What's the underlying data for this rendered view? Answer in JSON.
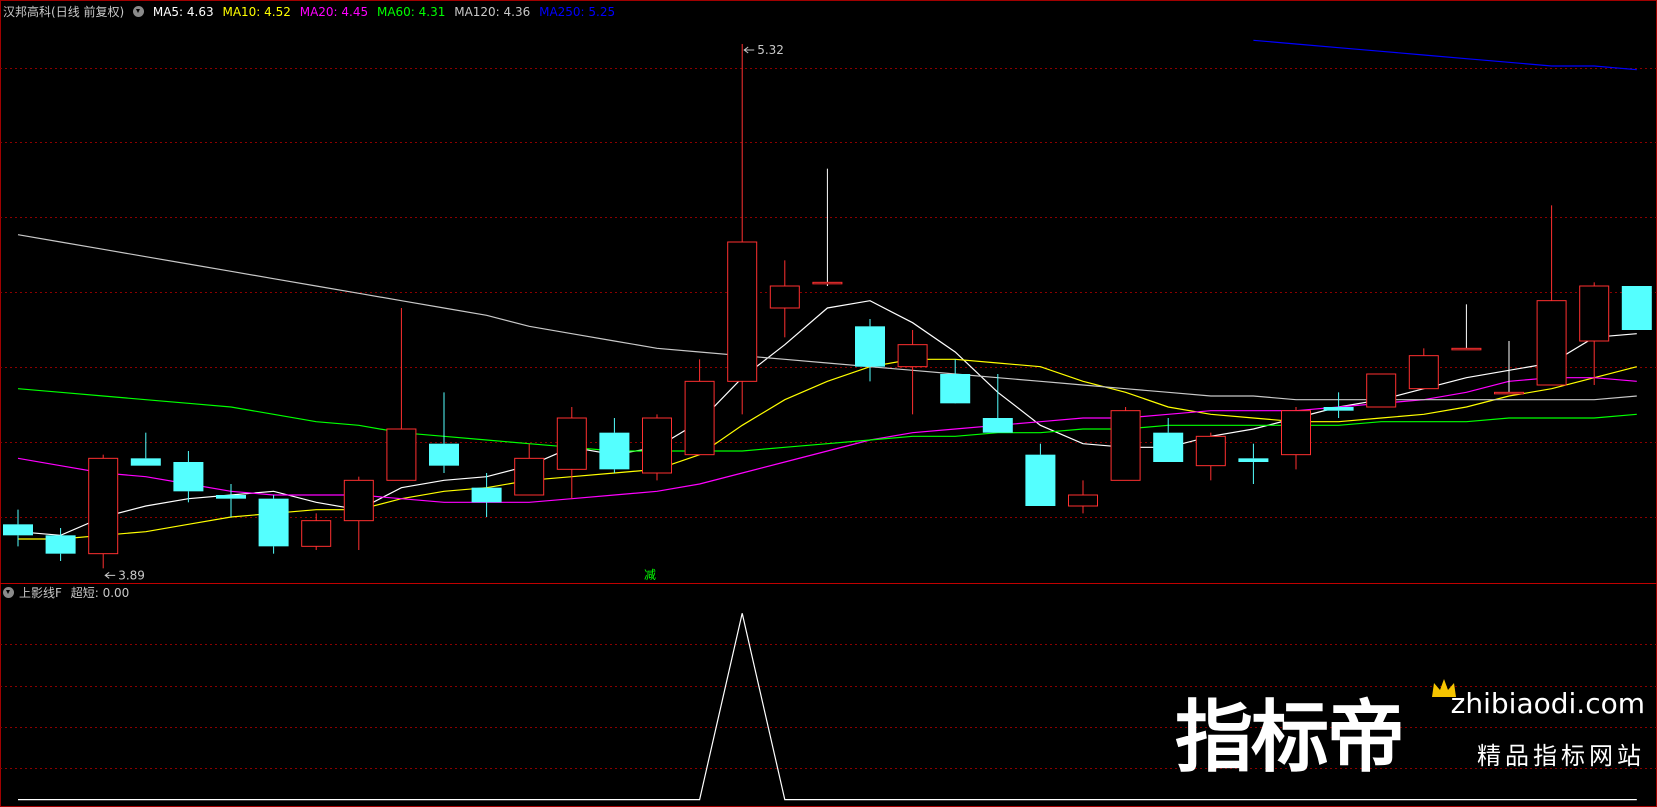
{
  "header": {
    "stock_name": "汉邦高科",
    "period": "(日线 前复权)",
    "ma": [
      {
        "label": "MA5: 4.63",
        "color": "#ffffff"
      },
      {
        "label": "MA10: 4.52",
        "color": "#ffff00"
      },
      {
        "label": "MA20: 4.45",
        "color": "#ff00ff"
      },
      {
        "label": "MA60: 4.31",
        "color": "#00ff00"
      },
      {
        "label": "MA120: 4.36",
        "color": "#c8c8c8"
      },
      {
        "label": "MA250: 5.25",
        "color": "#0000ff"
      }
    ]
  },
  "indicator": {
    "name": "上影线F",
    "series_label": "超短: 0.00"
  },
  "annotations": {
    "high_label": "5.32",
    "low_label": "3.89",
    "marker_text": "减"
  },
  "watermark": {
    "brand": "指标帝",
    "site": "zhibiaodi.com",
    "tagline": "精品指标网站"
  },
  "colors": {
    "up": "#ff3030",
    "down": "#54ffff",
    "ma5": "#ffffff",
    "ma10": "#ffff00",
    "ma20": "#ff00ff",
    "ma60": "#00ff00",
    "ma120": "#c8c8c8",
    "ma250": "#0000ff",
    "grid": "#8b0000"
  },
  "chart_data": [
    {
      "type": "candlestick",
      "ylim": [
        3.85,
        5.38
      ],
      "candles": [
        {
          "o": 4.01,
          "h": 4.05,
          "l": 3.95,
          "c": 3.98
        },
        {
          "o": 3.98,
          "h": 4.0,
          "l": 3.91,
          "c": 3.93
        },
        {
          "o": 3.93,
          "h": 4.2,
          "l": 3.89,
          "c": 4.19
        },
        {
          "o": 4.19,
          "h": 4.26,
          "l": 4.17,
          "c": 4.17
        },
        {
          "o": 4.18,
          "h": 4.21,
          "l": 4.07,
          "c": 4.1
        },
        {
          "o": 4.09,
          "h": 4.12,
          "l": 4.03,
          "c": 4.08
        },
        {
          "o": 4.08,
          "h": 4.09,
          "l": 3.93,
          "c": 3.95
        },
        {
          "o": 3.95,
          "h": 4.04,
          "l": 3.94,
          "c": 4.02
        },
        {
          "o": 4.02,
          "h": 4.14,
          "l": 3.94,
          "c": 4.13
        },
        {
          "o": 4.13,
          "h": 4.6,
          "l": 4.13,
          "c": 4.27
        },
        {
          "o": 4.23,
          "h": 4.37,
          "l": 4.15,
          "c": 4.17
        },
        {
          "o": 4.11,
          "h": 4.15,
          "l": 4.03,
          "c": 4.07
        },
        {
          "o": 4.09,
          "h": 4.23,
          "l": 4.09,
          "c": 4.19
        },
        {
          "o": 4.16,
          "h": 4.33,
          "l": 4.08,
          "c": 4.3
        },
        {
          "o": 4.26,
          "h": 4.3,
          "l": 4.15,
          "c": 4.16
        },
        {
          "o": 4.15,
          "h": 4.31,
          "l": 4.13,
          "c": 4.3
        },
        {
          "o": 4.2,
          "h": 4.46,
          "l": 4.2,
          "c": 4.4
        },
        {
          "o": 4.4,
          "h": 5.32,
          "l": 4.31,
          "c": 4.78
        },
        {
          "o": 4.6,
          "h": 4.73,
          "l": 4.52,
          "c": 4.66
        },
        {
          "o": 4.67,
          "h": 4.98,
          "l": 4.66,
          "c": 4.67
        },
        {
          "o": 4.55,
          "h": 4.57,
          "l": 4.4,
          "c": 4.44
        },
        {
          "o": 4.44,
          "h": 4.54,
          "l": 4.31,
          "c": 4.5
        },
        {
          "o": 4.42,
          "h": 4.46,
          "l": 4.35,
          "c": 4.34
        },
        {
          "o": 4.3,
          "h": 4.42,
          "l": 4.26,
          "c": 4.26
        },
        {
          "o": 4.2,
          "h": 4.23,
          "l": 4.06,
          "c": 4.06
        },
        {
          "o": 4.06,
          "h": 4.13,
          "l": 4.04,
          "c": 4.09
        },
        {
          "o": 4.13,
          "h": 4.33,
          "l": 4.13,
          "c": 4.32
        },
        {
          "o": 4.26,
          "h": 4.3,
          "l": 4.18,
          "c": 4.18
        },
        {
          "o": 4.17,
          "h": 4.26,
          "l": 4.13,
          "c": 4.25
        },
        {
          "o": 4.19,
          "h": 4.23,
          "l": 4.12,
          "c": 4.18
        },
        {
          "o": 4.2,
          "h": 4.33,
          "l": 4.16,
          "c": 4.32
        },
        {
          "o": 4.33,
          "h": 4.37,
          "l": 4.3,
          "c": 4.32
        },
        {
          "o": 4.33,
          "h": 4.42,
          "l": 4.33,
          "c": 4.42
        },
        {
          "o": 4.38,
          "h": 4.49,
          "l": 4.38,
          "c": 4.47
        },
        {
          "o": 4.49,
          "h": 4.61,
          "l": 4.49,
          "c": 4.49
        },
        {
          "o": 4.37,
          "h": 4.51,
          "l": 4.37,
          "c": 4.37
        },
        {
          "o": 4.39,
          "h": 4.88,
          "l": 4.39,
          "c": 4.62
        },
        {
          "o": 4.51,
          "h": 4.67,
          "l": 4.39,
          "c": 4.66
        },
        {
          "o": 4.66,
          "h": 4.66,
          "l": 4.54,
          "c": 4.54
        }
      ],
      "ma_lines": [
        {
          "name": "MA5",
          "values": [
            3.99,
            3.98,
            4.03,
            4.06,
            4.08,
            4.09,
            4.1,
            4.07,
            4.05,
            4.11,
            4.13,
            4.14,
            4.17,
            4.22,
            4.2,
            4.22,
            4.29,
            4.41,
            4.5,
            4.6,
            4.62,
            4.56,
            4.48,
            4.37,
            4.28,
            4.23,
            4.22,
            4.22,
            4.25,
            4.27,
            4.3,
            4.33,
            4.35,
            4.38,
            4.41,
            4.43,
            4.45,
            4.52,
            4.53
          ]
        },
        {
          "name": "MA10",
          "values": [
            3.97,
            3.97,
            3.98,
            3.99,
            4.01,
            4.03,
            4.04,
            4.05,
            4.05,
            4.08,
            4.1,
            4.11,
            4.13,
            4.14,
            4.15,
            4.16,
            4.2,
            4.28,
            4.35,
            4.4,
            4.44,
            4.46,
            4.46,
            4.45,
            4.44,
            4.4,
            4.37,
            4.33,
            4.31,
            4.3,
            4.29,
            4.29,
            4.3,
            4.31,
            4.33,
            4.36,
            4.38,
            4.41,
            4.44
          ]
        },
        {
          "name": "MA20",
          "values": [
            4.19,
            4.17,
            4.15,
            4.14,
            4.12,
            4.1,
            4.09,
            4.09,
            4.09,
            4.08,
            4.07,
            4.07,
            4.07,
            4.08,
            4.09,
            4.1,
            4.12,
            4.15,
            4.18,
            4.21,
            4.24,
            4.26,
            4.27,
            4.28,
            4.29,
            4.3,
            4.3,
            4.31,
            4.32,
            4.32,
            4.32,
            4.33,
            4.34,
            4.35,
            4.37,
            4.4,
            4.41,
            4.41,
            4.4
          ]
        },
        {
          "name": "MA60",
          "values": [
            4.38,
            4.37,
            4.36,
            4.35,
            4.34,
            4.33,
            4.31,
            4.29,
            4.28,
            4.26,
            4.25,
            4.24,
            4.23,
            4.22,
            4.21,
            4.21,
            4.21,
            4.21,
            4.22,
            4.23,
            4.24,
            4.25,
            4.25,
            4.26,
            4.26,
            4.27,
            4.27,
            4.28,
            4.28,
            4.28,
            4.28,
            4.28,
            4.29,
            4.29,
            4.29,
            4.3,
            4.3,
            4.3,
            4.31
          ]
        },
        {
          "name": "MA120",
          "values": [
            4.8,
            4.78,
            4.76,
            4.74,
            4.72,
            4.7,
            4.68,
            4.66,
            4.64,
            4.62,
            4.6,
            4.58,
            4.55,
            4.53,
            4.51,
            4.49,
            4.48,
            4.47,
            4.46,
            4.45,
            4.44,
            4.43,
            4.42,
            4.41,
            4.4,
            4.39,
            4.38,
            4.37,
            4.36,
            4.36,
            4.35,
            4.35,
            4.35,
            4.35,
            4.35,
            4.35,
            4.35,
            4.35,
            4.36
          ]
        },
        {
          "name": "MA250",
          "start_index": 29,
          "values": [
            5.33,
            5.32,
            5.31,
            5.3,
            5.29,
            5.28,
            5.27,
            5.26,
            5.26,
            5.25
          ]
        }
      ],
      "annotations": [
        {
          "type": "high",
          "index": 17,
          "value": 5.32
        },
        {
          "type": "low",
          "index": 2,
          "value": 3.89
        }
      ]
    },
    {
      "type": "line",
      "series": [
        {
          "name": "超短",
          "values": [
            0,
            0,
            0,
            0,
            0,
            0,
            0,
            0,
            0,
            0,
            0,
            0,
            0,
            0,
            0,
            0,
            0,
            1,
            0,
            0,
            0,
            0,
            0,
            0,
            0,
            0,
            0,
            0,
            0,
            0,
            0,
            0,
            0,
            0,
            0,
            0,
            0,
            0,
            0
          ]
        }
      ],
      "ylim": [
        -0.04,
        1.05
      ]
    }
  ]
}
